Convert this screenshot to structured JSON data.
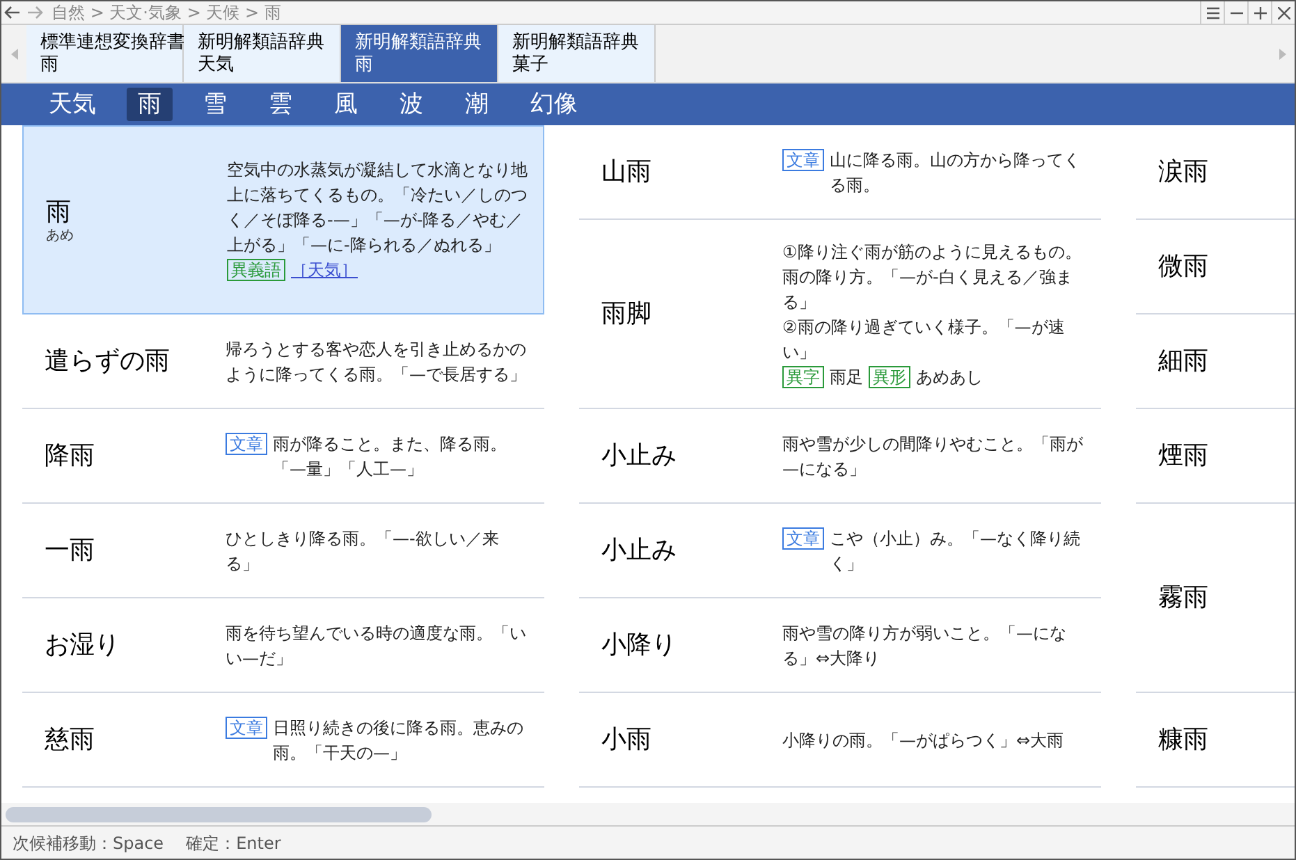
{
  "title_bar": {
    "breadcrumb": "自然 > 天文·気象 > 天候 > 雨"
  },
  "dictionary_tabs": [
    {
      "dictionary": "標準連想変換辞書",
      "word": "雨",
      "selected": false
    },
    {
      "dictionary": "新明解類語辞典",
      "word": "天気",
      "selected": false
    },
    {
      "dictionary": "新明解類語辞典",
      "word": "雨",
      "selected": true
    },
    {
      "dictionary": "新明解類語辞典",
      "word": "菓子",
      "selected": false
    }
  ],
  "categories": [
    {
      "label": "天気",
      "selected": false
    },
    {
      "label": "雨",
      "selected": true
    },
    {
      "label": "雪",
      "selected": false
    },
    {
      "label": "雲",
      "selected": false
    },
    {
      "label": "風",
      "selected": false
    },
    {
      "label": "波",
      "selected": false
    },
    {
      "label": "潮",
      "selected": false
    },
    {
      "label": "幻像",
      "selected": false
    }
  ],
  "columns": [
    {
      "entries": [
        {
          "term": "雨",
          "reading": "あめ",
          "selected": true,
          "lines": [
            [
              {
                "kind": "text",
                "text": "空気中の水蒸気が凝結して水滴となり地上に落ちてくるもの。「冷たい／しのつく／そぼ降る-—」「—が-降る／やむ／上がる」「—に-降られる／ぬれる」"
              }
            ],
            [
              {
                "kind": "tag",
                "text": "異義語",
                "color": "#2a9a3a"
              },
              {
                "kind": "link",
                "text": "［天気］"
              }
            ]
          ]
        },
        {
          "term": "遣らずの雨",
          "selected": false,
          "lines": [
            [
              {
                "kind": "text",
                "text": "帰ろうとする客や恋人を引き止めるかのように降ってくる雨。「—で長居する」"
              }
            ]
          ]
        },
        {
          "term": "降雨",
          "selected": false,
          "lines": [
            [
              {
                "kind": "tag",
                "text": "文章",
                "color": "#3b7be0"
              },
              {
                "kind": "text",
                "text": "雨が降ること。また、降る雨。「—量」「人工—」"
              }
            ]
          ]
        },
        {
          "term": "一雨",
          "selected": false,
          "lines": [
            [
              {
                "kind": "text",
                "text": "ひとしきり降る雨。「—-欲しい／来る」"
              }
            ]
          ]
        },
        {
          "term": "お湿り",
          "selected": false,
          "lines": [
            [
              {
                "kind": "text",
                "text": "雨を待ち望んでいる時の適度な雨。「いい—だ」"
              }
            ]
          ]
        },
        {
          "term": "慈雨",
          "selected": false,
          "lines": [
            [
              {
                "kind": "tag",
                "text": "文章",
                "color": "#3b7be0"
              },
              {
                "kind": "text",
                "text": "日照り続きの後に降る雨。恵みの雨。「干天の—」"
              }
            ]
          ]
        }
      ]
    },
    {
      "entries": [
        {
          "term": "山雨",
          "selected": false,
          "lines": [
            [
              {
                "kind": "tag",
                "text": "文章",
                "color": "#3b7be0"
              },
              {
                "kind": "text",
                "text": "山に降る雨。山の方から降ってくる雨。"
              }
            ]
          ]
        },
        {
          "term": "雨脚",
          "selected": false,
          "lines": [
            [
              {
                "kind": "text",
                "text": "①降り注ぐ雨が筋のように見えるもの。雨の降り方。「—が-白く見える／強まる」"
              }
            ],
            [
              {
                "kind": "text",
                "text": "②雨の降り過ぎていく様子。「—が速い」"
              }
            ],
            [
              {
                "kind": "tag",
                "text": "異字",
                "color": "#2a9a3a"
              },
              {
                "kind": "text",
                "text": "雨足"
              },
              {
                "kind": "tag",
                "text": "異形",
                "color": "#2a9a3a"
              },
              {
                "kind": "text",
                "text": "あめあし"
              }
            ]
          ]
        },
        {
          "term": "小止み",
          "selected": false,
          "lines": [
            [
              {
                "kind": "text",
                "text": "雨や雪が少しの間降りやむこと。「雨が—になる」"
              }
            ]
          ]
        },
        {
          "term": "小止み",
          "selected": false,
          "lines": [
            [
              {
                "kind": "tag",
                "text": "文章",
                "color": "#3b7be0"
              },
              {
                "kind": "text",
                "text": "こや（小止）み。「—なく降り続く」"
              }
            ]
          ]
        },
        {
          "term": "小降り",
          "selected": false,
          "lines": [
            [
              {
                "kind": "text",
                "text": "雨や雪の降り方が弱いこと。「—になる」⇔大降り"
              }
            ]
          ]
        },
        {
          "term": "小雨",
          "selected": false,
          "lines": [
            [
              {
                "kind": "text",
                "text": "小降りの雨。「—がぱらつく」⇔大雨"
              }
            ]
          ]
        }
      ]
    },
    {
      "entries": [
        {
          "term": "涙雨",
          "selected": false
        },
        {
          "term": "微雨",
          "selected": false
        },
        {
          "term": "細雨",
          "selected": false
        },
        {
          "term": "煙雨",
          "selected": false
        },
        {
          "term": "霧雨",
          "selected": false
        },
        {
          "term": "糠雨",
          "selected": false
        }
      ]
    }
  ],
  "status_bar": [
    "次候補移動：Space",
    "確定：Enter"
  ]
}
